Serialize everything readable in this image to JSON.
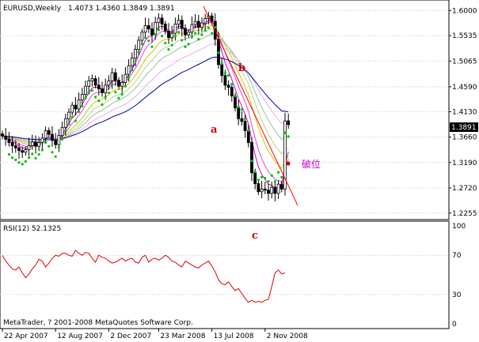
{
  "chart_data": [
    {
      "type": "candlestick",
      "title": "EURUSD,Weekly",
      "ohlc_header": "1.4073 1.4360 1.3849 1.3891",
      "current_price": "1.3891",
      "ylim": [
        1.215,
        1.618
      ],
      "y_ticks": [
        "1.6000",
        "1.5535",
        "1.5065",
        "1.4590",
        "1.4130",
        "1.3660",
        "1.3190",
        "1.2720",
        "1.2255"
      ],
      "y_tick_values": [
        1.6,
        1.5535,
        1.5065,
        1.459,
        1.413,
        1.366,
        1.319,
        1.272,
        1.2255
      ],
      "x_ticks": [
        "22 Apr 2007",
        "12 Aug 2007",
        "2 Dec 2007",
        "23 Mar 2008",
        "13 Jul 2008",
        "2 Nov 2008"
      ],
      "x_tick_index": [
        0,
        16,
        32,
        47,
        63,
        79
      ],
      "price_closes": [
        1.368,
        1.362,
        1.356,
        1.35,
        1.346,
        1.341,
        1.338,
        1.343,
        1.35,
        1.357,
        1.349,
        1.356,
        1.364,
        1.378,
        1.371,
        1.36,
        1.352,
        1.369,
        1.384,
        1.4,
        1.412,
        1.425,
        1.418,
        1.435,
        1.445,
        1.46,
        1.47,
        1.474,
        1.462,
        1.455,
        1.448,
        1.462,
        1.47,
        1.485,
        1.471,
        1.46,
        1.467,
        1.482,
        1.498,
        1.512,
        1.528,
        1.545,
        1.56,
        1.572,
        1.566,
        1.555,
        1.578,
        1.586,
        1.575,
        1.562,
        1.55,
        1.558,
        1.575,
        1.582,
        1.567,
        1.555,
        1.56,
        1.574,
        1.58,
        1.569,
        1.577,
        1.585,
        1.59,
        1.58,
        1.547,
        1.5,
        1.48,
        1.462,
        1.458,
        1.442,
        1.42,
        1.4,
        1.395,
        1.378,
        1.356,
        1.3,
        1.28,
        1.265,
        1.27,
        1.268,
        1.262,
        1.273,
        1.262,
        1.279,
        1.27,
        1.396,
        1.389
      ],
      "annotations": [
        "a",
        "b",
        "c",
        "破位"
      ]
    },
    {
      "type": "line",
      "title": "RSI(12) 52.1325",
      "ylim": [
        0,
        100
      ],
      "y_ticks": [
        "100",
        "70",
        "30",
        "0"
      ],
      "y_tick_values": [
        100,
        70,
        30,
        0
      ],
      "series": [
        {
          "name": "RSI(12)",
          "values": [
            70,
            64,
            60,
            56,
            55,
            58,
            52,
            47,
            51,
            56,
            60,
            66,
            64,
            58,
            62,
            67,
            70,
            69,
            72,
            72,
            70,
            69,
            75,
            72,
            70,
            73,
            72,
            67,
            63,
            70,
            68,
            67,
            64,
            62,
            63,
            65,
            67,
            64,
            66,
            67,
            63,
            62,
            68,
            70,
            63,
            66,
            67,
            65,
            67,
            70,
            68,
            64,
            63,
            60,
            58,
            64,
            62,
            60,
            58,
            57,
            60,
            62,
            64,
            59,
            53,
            45,
            41,
            40,
            43,
            38,
            34,
            36,
            31,
            26,
            22,
            24,
            22,
            23,
            22,
            24,
            25,
            38,
            52,
            55,
            51,
            52
          ]
        }
      ]
    }
  ],
  "footer": "MetaTrader, ? 2001-2008 MetaQuotes Software Corp.",
  "colors": {
    "grid": "#c8c8c8",
    "candle": "#000000",
    "sar": "#00c000",
    "rsi": "#e00000",
    "annotation": "#cc0000",
    "breakout_label": "#cc00cc",
    "trendline": "#ff0000"
  }
}
